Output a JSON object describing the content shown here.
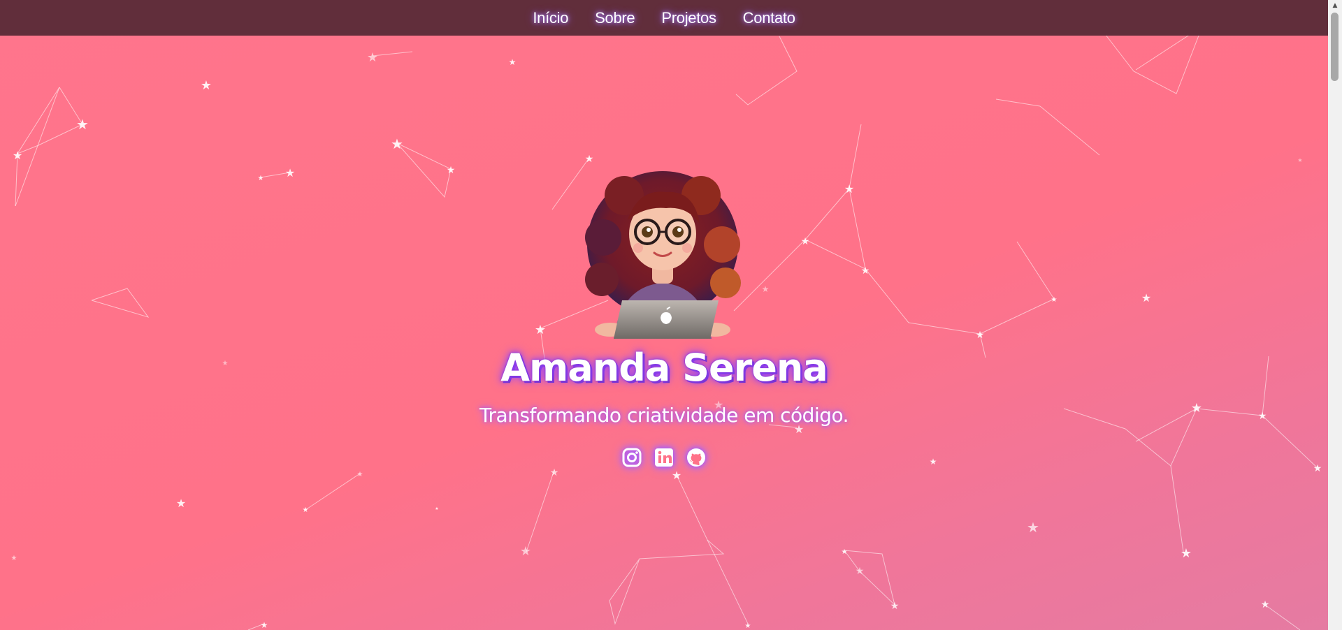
{
  "nav": {
    "items": [
      {
        "label": "Início"
      },
      {
        "label": "Sobre"
      },
      {
        "label": "Projetos"
      },
      {
        "label": "Contato"
      }
    ]
  },
  "hero": {
    "name": "Amanda Serena",
    "tagline": "Transformando criatividade em código.",
    "avatar_icon": "cartoon-girl-with-laptop-avatar"
  },
  "socials": [
    {
      "icon": "instagram-icon"
    },
    {
      "icon": "linkedin-icon"
    },
    {
      "icon": "github-icon"
    }
  ],
  "colors": {
    "background": "#ff758c",
    "navbar": "#612e3b",
    "glow": "#9b4dff",
    "text": "#ffffff"
  },
  "scrollbar": {
    "up_arrow_icon": "scroll-up-arrow-icon"
  }
}
